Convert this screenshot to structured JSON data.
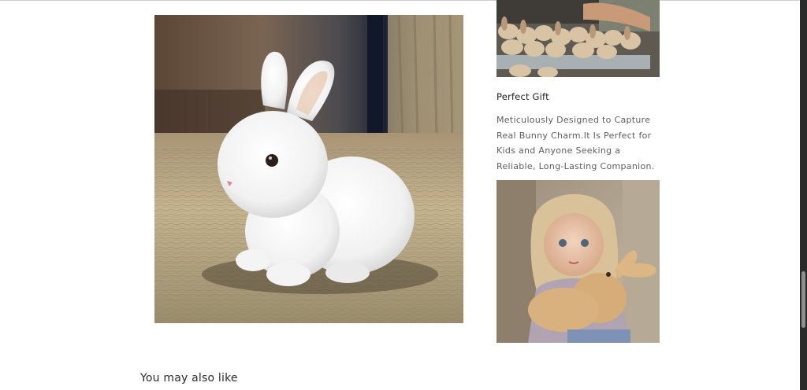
{
  "feature": {
    "title": "Perfect Gift",
    "description": "Meticulously Designed to Capture Real Bunny Charm.It Is Perfect for Kids and Anyone Seeking a Reliable, Long-Lasting Companion."
  },
  "recommendations": {
    "heading": "You may also like"
  },
  "images": {
    "main": "white-bunny-plush-photo",
    "factory": "plush-factory-photo",
    "girl": "girl-hugging-bunny-photo"
  },
  "colors": {
    "background": "#ffffff",
    "text": "#1f1f1f",
    "muted_text": "#5e5e5e",
    "scrollbar_track": "#2a2a2a",
    "scrollbar_thumb": "#8e8e8e"
  }
}
